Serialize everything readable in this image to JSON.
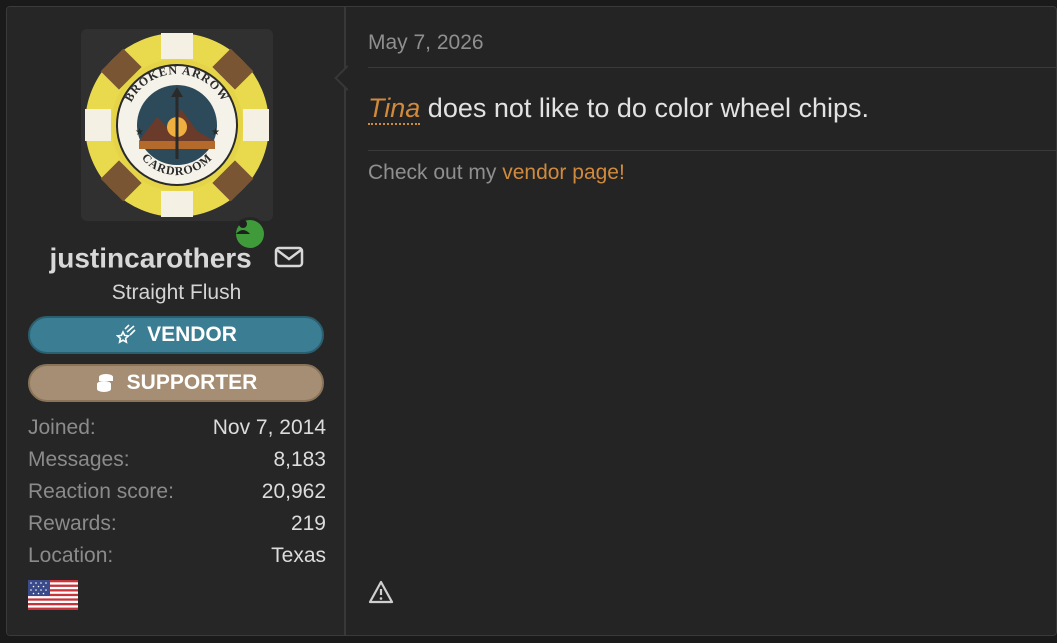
{
  "user": {
    "avatar_lettering_top": "BROKEN ARROW",
    "avatar_lettering_bottom": "CARDROOM",
    "username": "justincarothers",
    "title": "Straight Flush",
    "banners": [
      {
        "label": "VENDOR",
        "icon": "shooting-star-icon",
        "color": "#3b7d92"
      },
      {
        "label": "SUPPORTER",
        "icon": "coins-icon",
        "color": "#a58e73"
      }
    ],
    "stats": [
      {
        "key": "Joined:",
        "value": "Nov 7, 2014"
      },
      {
        "key": "Messages:",
        "value": "8,183"
      },
      {
        "key": "Reaction score:",
        "value": "20,962"
      },
      {
        "key": "Rewards:",
        "value": "219"
      },
      {
        "key": "Location:",
        "value": "Texas"
      }
    ],
    "flag_icon": "us-flag-icon",
    "online_icon": "user-online-icon"
  },
  "message": {
    "date": "May 7, 2026",
    "mention": "Tina",
    "body_rest": " does not like to do color wheel chips.",
    "signature_prefix": "Check out my ",
    "signature_link": "vendor page!",
    "report_icon": "warning-icon"
  },
  "colors": {
    "accent_orange": "#d08a3c",
    "online_green": "#3f9a3a"
  }
}
